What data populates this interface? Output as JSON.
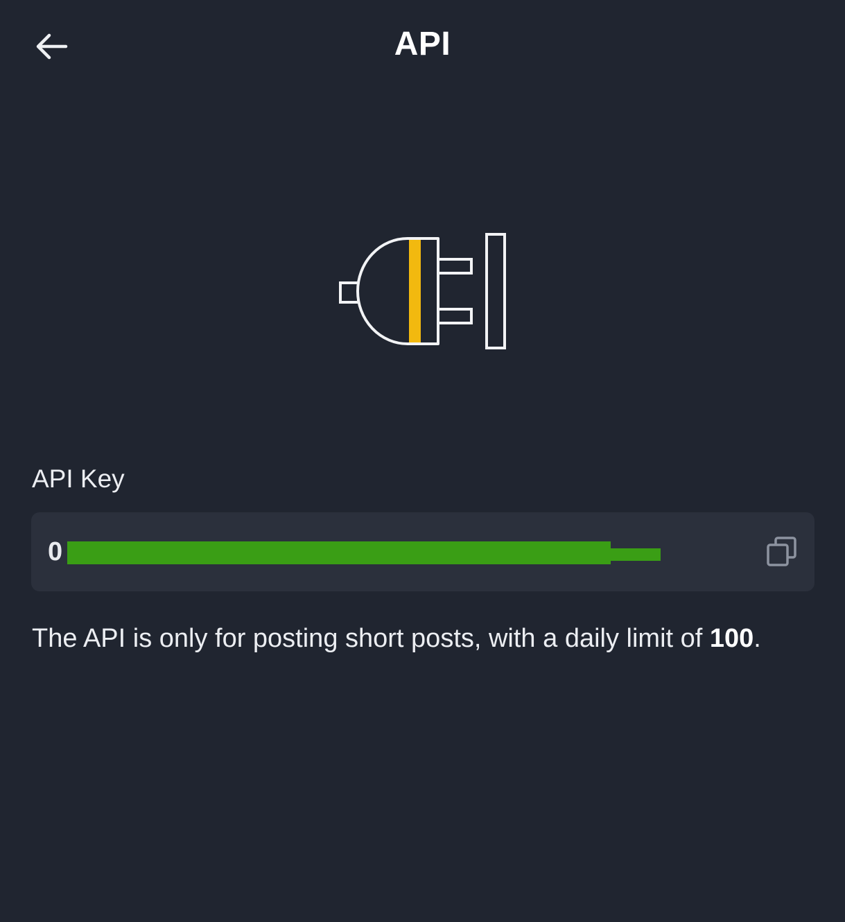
{
  "header": {
    "title": "API",
    "back_icon": "arrow-left-icon"
  },
  "illustration": {
    "icon": "plug-icon",
    "accent_color": "#f2b90f"
  },
  "api_key": {
    "label": "API Key",
    "value_visible_prefix": "0",
    "redacted": true,
    "copy_icon": "copy-icon"
  },
  "description": {
    "text_before": "The API is only for posting short posts, with a daily limit of",
    "limit_value": "100",
    "text_after": "."
  },
  "colors": {
    "background": "#202530",
    "field_background": "#2b303c",
    "redaction": "#3a9e15"
  }
}
